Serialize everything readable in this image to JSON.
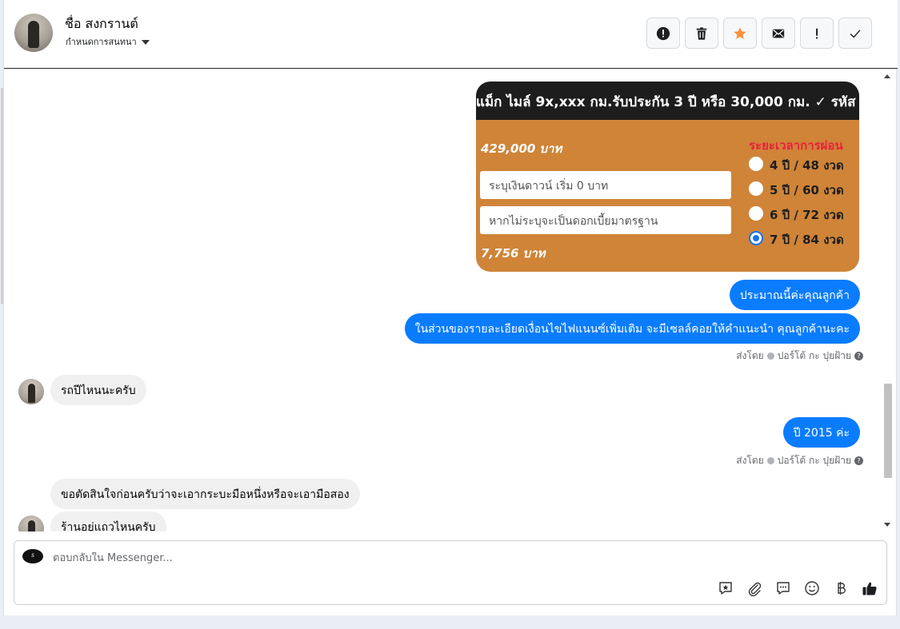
{
  "header": {
    "contact_name": "ชื่อ สงกรานต์",
    "conversation_setting": "กำหนดการสนทนา",
    "buttons": [
      {
        "name": "spam-button",
        "icon": "exclamation-circle-icon"
      },
      {
        "name": "delete-button",
        "icon": "trash-icon"
      },
      {
        "name": "star-button",
        "icon": "star-icon",
        "color": "#f7923a"
      },
      {
        "name": "mark-unread-button",
        "icon": "envelope-icon"
      },
      {
        "name": "mark-important-button",
        "icon": "exclamation-icon"
      },
      {
        "name": "mark-done-button",
        "icon": "check-icon"
      }
    ]
  },
  "card": {
    "banner": "แม็ก ไมล์ 9x,xxx กม.รับประกัน 3 ปี หรือ 30,000 กม. ✓ รหัส",
    "price": "429,000 บาท",
    "down_payment_placeholder": "ระบุเงินดาวน์ เริ่ม 0 บาท",
    "interest_placeholder": "หากไม่ระบุจะเป็นดอกเบี้ยมาตรฐาน",
    "monthly": "7,756 บาท",
    "period_title": "ระยะเวลาการผ่อน",
    "periods": [
      "4 ปี / 48 งวด",
      "5 ปี / 60 งวด",
      "6 ปี / 72 งวด",
      "7 ปี / 84 งวด"
    ],
    "selected_period": "7 ปี / 84 งวด"
  },
  "messages": [
    {
      "side": "out",
      "text": "ประมาณนี้ค่ะคุณลูกค้า"
    },
    {
      "side": "out",
      "text": "ในส่วนของรายละเอียดเงื่อนไขไฟแนนซ์เพิ่มเติม จะมีเซลล์คอยให้คำแนะนำ คุณลูกค้านะคะ"
    },
    {
      "side": "in",
      "text": "รถปีไหนนะครับ"
    },
    {
      "side": "out",
      "text": "ปี 2015 ค่ะ"
    },
    {
      "side": "in",
      "text": "ขอตัดสินใจก่อนครับว่าจะเอากระบะมือหนึ่งหรือจะเอามือสอง"
    },
    {
      "side": "in",
      "text": "ร้านอยู่แถวไหนครับ"
    }
  ],
  "sent_by": {
    "prefix": "ส่งโดย",
    "agent": "ปอร์โต้ กะ ปุยฝ้าย"
  },
  "composer": {
    "placeholder": "ตอบกลับใน Messenger...",
    "tools": [
      "saved-reply-icon",
      "attachment-icon",
      "chat-icon",
      "emoji-icon",
      "baht-icon",
      "thumbs-up-icon"
    ]
  }
}
